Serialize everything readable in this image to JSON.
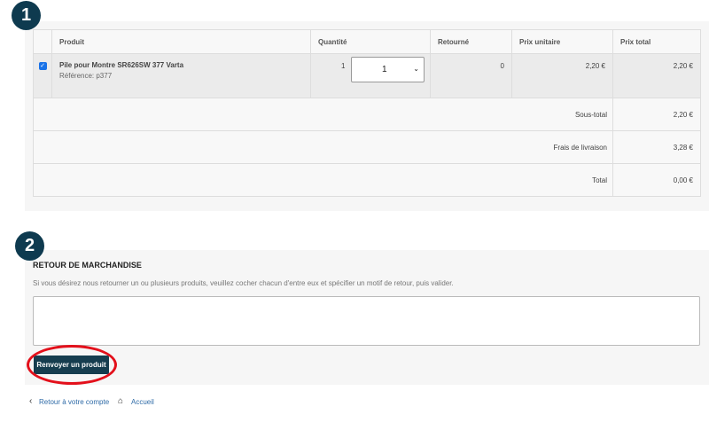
{
  "steps": {
    "one": "1",
    "two": "2"
  },
  "order_table": {
    "headers": {
      "produit": "Produit",
      "quantite": "Quantité",
      "retourne": "Retourné",
      "prix_unitaire": "Prix unitaire",
      "prix_total": "Prix total"
    },
    "item": {
      "checked": true,
      "check_glyph": "✓",
      "name": "Pile pour Montre SR626SW 377 Varta",
      "reference": "Référence: p377",
      "quantity": "1",
      "quantity_select": "1",
      "returned": "0",
      "unit_price": "2,20 €",
      "total_price": "2,20 €"
    },
    "summary": [
      {
        "label": "Sous-total",
        "value": "2,20 €"
      },
      {
        "label": "Frais de livraison",
        "value": "3,28 €"
      },
      {
        "label": "Total",
        "value": "0,00 €"
      }
    ]
  },
  "return_section": {
    "title": "RETOUR DE MARCHANDISE",
    "description": "Si vous désirez nous retourner un ou plusieurs produits, veuillez cocher chacun d'entre eux et spécifier un motif de retour, puis valider.",
    "textarea_value": "",
    "button_label": "Renvoyer un produit"
  },
  "footer": {
    "back_icon": "chevron-left-icon",
    "back_label": "Retour à votre compte",
    "home_icon": "home-icon",
    "home_label": "Accueil"
  },
  "colors": {
    "step_badge": "#0e3a4f",
    "button": "#163d4f",
    "highlight_oval": "#e3101b",
    "link": "#2f6ba7",
    "checkbox": "#1a73e8"
  }
}
